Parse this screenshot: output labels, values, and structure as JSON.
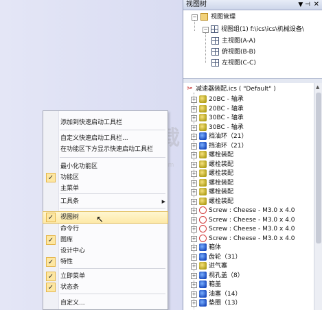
{
  "background": {
    "logo_text": "安下载",
    "logo_sub": "anxz.com"
  },
  "menu": {
    "items": [
      {
        "label": "添加到快速启动工具栏",
        "checked": false
      },
      {
        "label": "自定义快速启动工具栏...",
        "checked": false
      },
      {
        "label": "在功能区下方显示快速启动工具栏",
        "checked": false
      },
      {
        "label": "最小化功能区",
        "checked": false
      },
      {
        "label": "功能区",
        "checked": true
      },
      {
        "label": "主菜单",
        "checked": false
      },
      {
        "label": "工具条",
        "checked": false,
        "submenu": true
      },
      {
        "label": "视图树",
        "checked": true,
        "highlighted": true
      },
      {
        "label": "命令行",
        "checked": false
      },
      {
        "label": "图库",
        "checked": true
      },
      {
        "label": "设计中心",
        "checked": false
      },
      {
        "label": "特性",
        "checked": true
      },
      {
        "label": "立即菜单",
        "checked": true
      },
      {
        "label": "状态条",
        "checked": true
      },
      {
        "label": "自定义...",
        "checked": false
      }
    ],
    "check_glyph": "✓",
    "submenu_glyph": "▶"
  },
  "panel": {
    "title": "视图树",
    "pin_glyph": "▼ ⊣",
    "close_glyph": "✕",
    "views": {
      "root": "视图管理",
      "group": "视图组(1)  f:\\ics\\ics\\机械设备\\",
      "items": [
        "主视图(A-A)",
        "俯视图(B-B)",
        "左视图(C-C)"
      ]
    },
    "model": {
      "root": "减速器装配.ics ( \"Default\" )",
      "items": [
        {
          "label": "20BC - 轴承",
          "icon": "assembly"
        },
        {
          "label": "20BC - 轴承",
          "icon": "assembly"
        },
        {
          "label": "30BC - 轴承",
          "icon": "assembly"
        },
        {
          "label": "30BC - 轴承",
          "icon": "assembly"
        },
        {
          "label": "挡油环（21）",
          "icon": "part"
        },
        {
          "label": "挡油环（21）",
          "icon": "part"
        },
        {
          "label": "螺栓装配",
          "icon": "assembly"
        },
        {
          "label": "螺栓装配",
          "icon": "assembly"
        },
        {
          "label": "螺栓装配",
          "icon": "assembly"
        },
        {
          "label": "螺栓装配",
          "icon": "assembly"
        },
        {
          "label": "螺栓装配",
          "icon": "assembly"
        },
        {
          "label": "螺栓装配",
          "icon": "assembly"
        },
        {
          "label": "Screw : Cheese - M3.0 x 4.0",
          "icon": "screw"
        },
        {
          "label": "Screw : Cheese - M3.0 x 4.0",
          "icon": "screw"
        },
        {
          "label": "Screw : Cheese - M3.0 x 4.0",
          "icon": "screw"
        },
        {
          "label": "Screw : Cheese - M3.0 x 4.0",
          "icon": "screw"
        },
        {
          "label": "箱体",
          "icon": "part"
        },
        {
          "label": "齿轮（31）",
          "icon": "part"
        },
        {
          "label": "进气塞",
          "icon": "assembly"
        },
        {
          "label": "视孔盖（8）",
          "icon": "part"
        },
        {
          "label": "箱盖",
          "icon": "part"
        },
        {
          "label": "油塞（14）",
          "icon": "part"
        },
        {
          "label": "垫圈（13）",
          "icon": "part"
        }
      ]
    }
  }
}
